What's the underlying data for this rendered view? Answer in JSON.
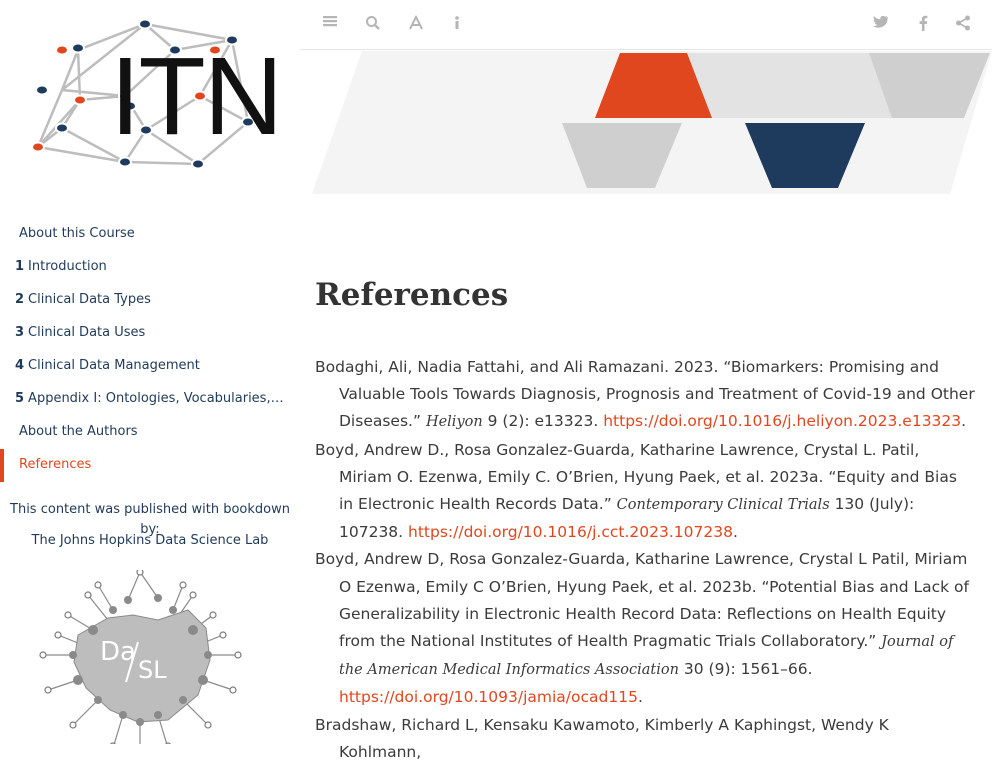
{
  "sidebar": {
    "logo_text": "ITN",
    "toc": [
      {
        "num": "",
        "label": "About this Course",
        "active": false
      },
      {
        "num": "1",
        "label": "Introduction",
        "active": false
      },
      {
        "num": "2",
        "label": "Clinical Data Types",
        "active": false
      },
      {
        "num": "3",
        "label": "Clinical Data Uses",
        "active": false
      },
      {
        "num": "4",
        "label": "Clinical Data Management",
        "active": false
      },
      {
        "num": "5",
        "label": "Appendix I: Ontologies, Vocabularies, T...",
        "active": false
      },
      {
        "num": "",
        "label": "About the Authors",
        "active": false
      },
      {
        "num": "",
        "label": "References",
        "active": true
      }
    ],
    "published_line1": "This content was published with bookdown by:",
    "published_line2": "The Johns Hopkins Data Science Lab",
    "dasl_text_left": "Da",
    "dasl_text_right": "SL"
  },
  "toolbar": {
    "left_icons": [
      "toc-toggle-icon",
      "search-icon",
      "font-settings-icon",
      "info-icon"
    ],
    "right_icons": [
      "twitter-icon",
      "facebook-icon",
      "share-icon"
    ]
  },
  "colors": {
    "accent": "#e0471e",
    "navy": "#1f3a5a",
    "banner_grey": "#d0d0d0"
  },
  "main": {
    "title": "References",
    "references": [
      {
        "text": "Bodaghi, Ali, Nadia Fattahi, and Ali Ramazani. 2023. “Biomarkers: Promising and Valuable Tools Towards Diagnosis, Prognosis and Treatment of Covid-19 and Other Diseases.” ",
        "journal": "Heliyon",
        "details": " 9 (2): e13323. ",
        "link": "https://doi.org/10.1016/j.heliyon.2023.e13323",
        "end": "."
      },
      {
        "text": "Boyd, Andrew D., Rosa Gonzalez-Guarda, Katharine Lawrence, Crystal L. Patil, Miriam O. Ezenwa, Emily C. O’Brien, Hyung Paek, et al. 2023a. “Equity and Bias in Electronic Health Records Data.” ",
        "journal": "Contemporary Clinical Trials",
        "details": " 130 (July): 107238. ",
        "link": "https://doi.org/10.1016/j.cct.2023.107238",
        "end": "."
      },
      {
        "text": "Boyd, Andrew D, Rosa Gonzalez-Guarda, Katharine Lawrence, Crystal L Patil, Miriam O Ezenwa, Emily C O’Brien, Hyung Paek, et al. 2023b. “Potential Bias and Lack of Generalizability in Electronic Health Record Data: Reflections on Health Equity from the National Institutes of Health Pragmatic Trials Collaboratory.” ",
        "journal": "Journal of the American Medical Informatics Association",
        "details": " 30 (9): 1561–66. ",
        "link": "https://doi.org/10.1093/jamia/ocad115",
        "end": "."
      },
      {
        "text": "Bradshaw, Richard L, Kensaku Kawamoto, Kimberly A Kaphingst, Wendy K Kohlmann,",
        "journal": "",
        "details": "",
        "link": "",
        "end": ""
      }
    ]
  }
}
